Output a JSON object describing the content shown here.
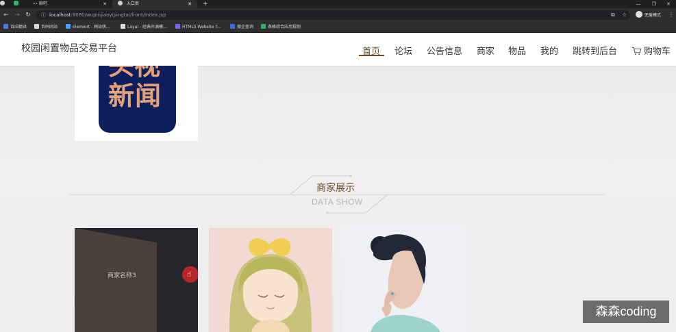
{
  "browser": {
    "tabs": [
      {
        "label": ""
      },
      {
        "label": ""
      },
      {
        "label": "•• 聊吧"
      },
      {
        "label": "入口页"
      }
    ],
    "url_host": "localhost",
    "url_path": ":8080/wupinjiaoyipingtai/front/index.jsp",
    "incognito_label": "无痕模式",
    "bookmarks": [
      {
        "label": "百应翻译",
        "color": "#4a7be8"
      },
      {
        "label": "页码网站",
        "color": "#dddddd"
      },
      {
        "label": "Element - 网站快...",
        "color": "#409eff"
      },
      {
        "label": "Layui - 经典开源模...",
        "color": "#dddddd"
      },
      {
        "label": "HTML5 Website T...",
        "color": "#7b68ee"
      },
      {
        "label": "搜企查询",
        "color": "#3b6fd1"
      },
      {
        "label": "表格综合应用规划",
        "color": "#2fb26a"
      }
    ]
  },
  "site": {
    "title": "校园闲置物品交易平台",
    "nav": [
      {
        "label": "首页",
        "active": true
      },
      {
        "label": "论坛"
      },
      {
        "label": "公告信息"
      },
      {
        "label": "商家"
      },
      {
        "label": "物品"
      },
      {
        "label": "我的"
      },
      {
        "label": "跳转到后台"
      },
      {
        "label": "购物车",
        "icon": "cart-icon"
      }
    ]
  },
  "news_logo": {
    "line1": "头视",
    "line2": "新闻"
  },
  "section": {
    "title": "商家展示",
    "subtitle": "DATA SHOW"
  },
  "shops": [
    {
      "name": "商家名称3"
    },
    {
      "name": ""
    },
    {
      "name": ""
    }
  ],
  "watermark": "森森coding",
  "colors": {
    "accent": "#6b4c2a",
    "header_bg": "#ffffff",
    "page_bg": "#efedef"
  }
}
